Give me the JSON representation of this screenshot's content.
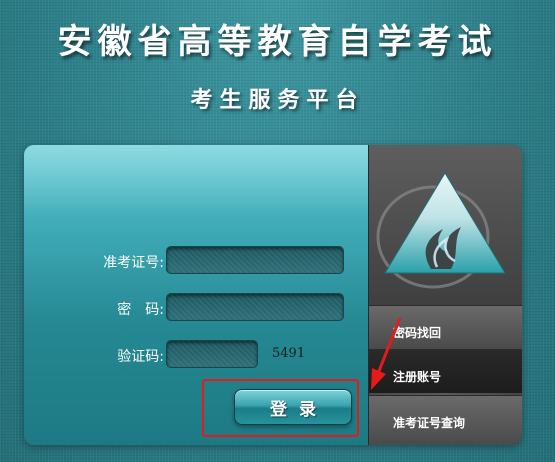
{
  "header": {
    "title": "安徽省高等教育自学考试",
    "subtitle": "考生服务平台"
  },
  "login_form": {
    "exam_id_label": "准考证号:",
    "exam_id_value": "",
    "password_label": "密　码:",
    "password_value": "",
    "captcha_label": "验证码:",
    "captcha_value": "",
    "captcha_code": "5491",
    "login_button": "登录"
  },
  "side_menu": {
    "items": [
      {
        "label": "密码找回"
      },
      {
        "label": "注册账号"
      },
      {
        "label": "准考证号查询"
      }
    ]
  },
  "annotation": {
    "highlight_color": "#e31b1b",
    "arrow_color": "#e31b1b",
    "arrow_target": "注册账号"
  },
  "colors": {
    "background": "#2f8590",
    "panel_top": "#62ccd6",
    "panel_bottom": "#1d7a84",
    "side_panel": "#4a4a4a"
  },
  "icons": {
    "logo": "mountain-flame-logo-icon"
  }
}
